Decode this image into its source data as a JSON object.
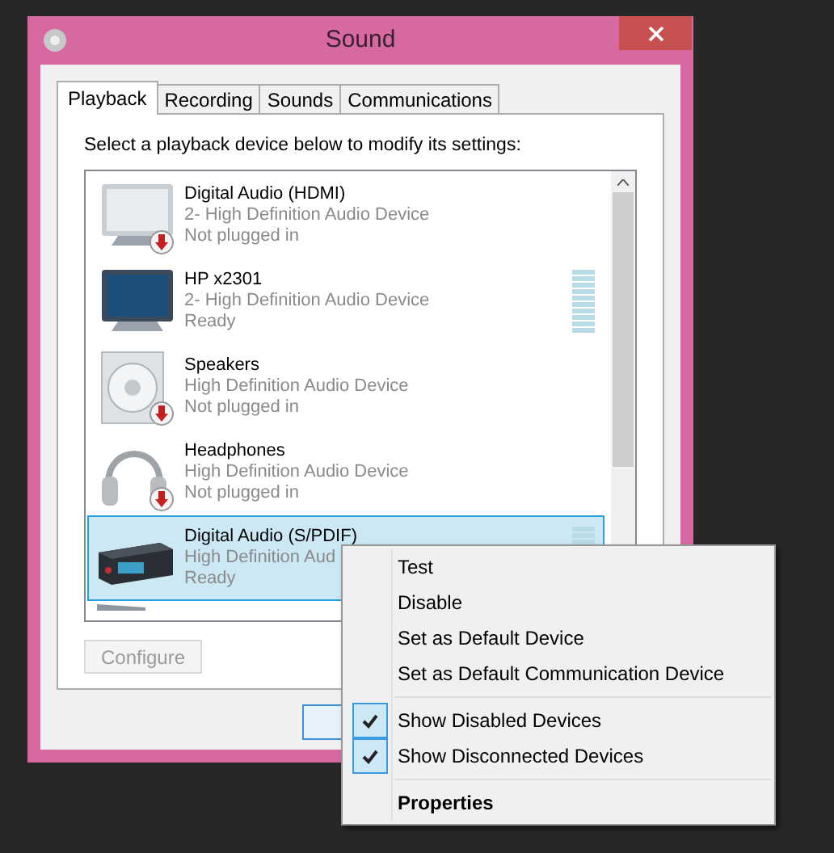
{
  "window": {
    "title": "Sound"
  },
  "tabs": [
    {
      "label": "Playback",
      "selected": true
    },
    {
      "label": "Recording",
      "selected": false
    },
    {
      "label": "Sounds",
      "selected": false
    },
    {
      "label": "Communications",
      "selected": false
    }
  ],
  "instruction": "Select a playback device below to modify its settings:",
  "devices": [
    {
      "kind": "monitor",
      "name": "Digital Audio (HDMI)",
      "driver": "2- High Definition Audio Device",
      "status": "Not plugged in",
      "unplugged": true,
      "meter": false,
      "selected": false
    },
    {
      "kind": "tv",
      "name": "HP x2301",
      "driver": "2- High Definition Audio Device",
      "status": "Ready",
      "unplugged": false,
      "meter": true,
      "selected": false
    },
    {
      "kind": "speaker",
      "name": "Speakers",
      "driver": "High Definition Audio Device",
      "status": "Not plugged in",
      "unplugged": true,
      "meter": false,
      "selected": false
    },
    {
      "kind": "headphones",
      "name": "Headphones",
      "driver": "High Definition Audio Device",
      "status": "Not plugged in",
      "unplugged": true,
      "meter": false,
      "selected": false
    },
    {
      "kind": "receiver",
      "name": "Digital Audio (S/PDIF)",
      "driver": "High Definition Aud",
      "status": "Ready",
      "unplugged": false,
      "meter": true,
      "selected": true
    }
  ],
  "configure_button": {
    "label": "Configure",
    "disabled": true
  },
  "context_menu": [
    {
      "kind": "item",
      "label": "Test"
    },
    {
      "kind": "item",
      "label": "Disable"
    },
    {
      "kind": "item",
      "label": "Set as Default Device"
    },
    {
      "kind": "item",
      "label": "Set as Default Communication Device"
    },
    {
      "kind": "separator"
    },
    {
      "kind": "check",
      "label": "Show Disabled Devices",
      "checked": true
    },
    {
      "kind": "check",
      "label": "Show Disconnected Devices",
      "checked": true
    },
    {
      "kind": "separator"
    },
    {
      "kind": "default",
      "label": "Properties"
    }
  ]
}
